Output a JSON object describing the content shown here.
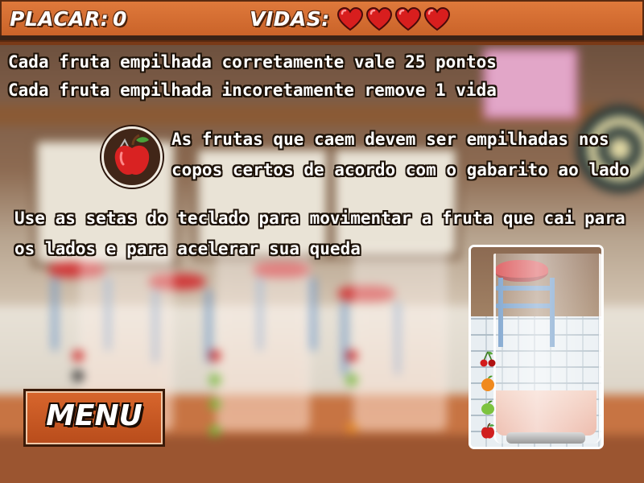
{
  "hud": {
    "score_label": "PLACAR:",
    "score_value": "0",
    "lives_label": "VIDAS:",
    "lives_count": 4,
    "heart_icon": "heart-icon",
    "heart_color": "#d81e1e"
  },
  "instructions": {
    "line1": "Cada fruta empilhada corretamente vale 25 pontos",
    "line2": "Cada fruta empilhada incoretamente remove 1 vida",
    "line3": "As frutas que caem devem ser empilhadas nos",
    "line4": "copos certos de acordo com o gabarito ao lado",
    "line5": "Use as setas do teclado para movimentar a fruta que cai para",
    "line6": "os lados e para acelerar sua queda",
    "badge_icon": "apple-icon"
  },
  "menu_button": {
    "label": "MENU"
  },
  "guide": {
    "fruit_order": [
      "cherry-icon",
      "orange-icon",
      "lime-icon",
      "apple-icon"
    ]
  },
  "colors": {
    "topbar": "#d86d33",
    "menu_button": "#c8571f",
    "text_outline": "#1d1208"
  }
}
